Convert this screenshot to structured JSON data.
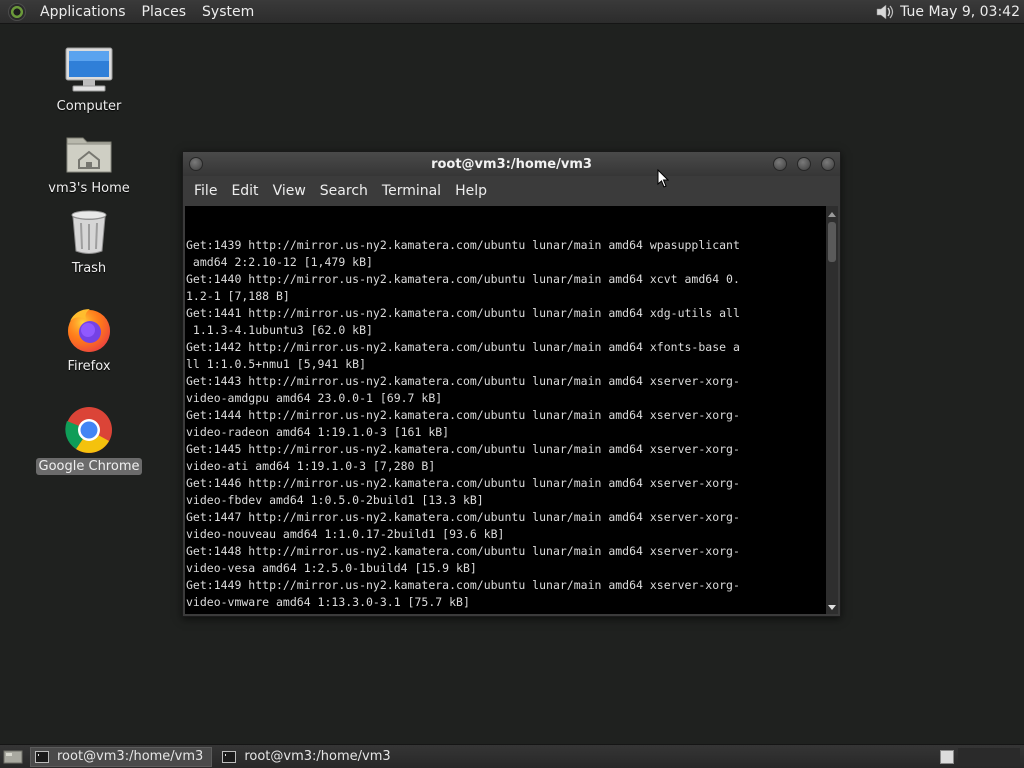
{
  "top_panel": {
    "menu": [
      "Applications",
      "Places",
      "System"
    ],
    "clock": "Tue May  9, 03:42",
    "volume_icon": "speaker-icon"
  },
  "desktop_icons": [
    {
      "label": "Computer",
      "icon": "computer-icon"
    },
    {
      "label": "vm3's Home",
      "icon": "home-folder-icon"
    },
    {
      "label": "Trash",
      "icon": "trash-icon"
    },
    {
      "label": "Firefox",
      "icon": "firefox-icon"
    },
    {
      "label": "Google Chrome",
      "icon": "chrome-icon",
      "selected": true
    }
  ],
  "terminal": {
    "title": "root@vm3:/home/vm3",
    "menu": [
      "File",
      "Edit",
      "View",
      "Search",
      "Terminal",
      "Help"
    ],
    "lines": [
      "Get:1439 http://mirror.us-ny2.kamatera.com/ubuntu lunar/main amd64 wpasupplicant",
      " amd64 2:2.10-12 [1,479 kB]",
      "Get:1440 http://mirror.us-ny2.kamatera.com/ubuntu lunar/main amd64 xcvt amd64 0.",
      "1.2-1 [7,188 B]",
      "Get:1441 http://mirror.us-ny2.kamatera.com/ubuntu lunar/main amd64 xdg-utils all",
      " 1.1.3-4.1ubuntu3 [62.0 kB]",
      "Get:1442 http://mirror.us-ny2.kamatera.com/ubuntu lunar/main amd64 xfonts-base a",
      "ll 1:1.0.5+nmu1 [5,941 kB]",
      "Get:1443 http://mirror.us-ny2.kamatera.com/ubuntu lunar/main amd64 xserver-xorg-",
      "video-amdgpu amd64 23.0.0-1 [69.7 kB]",
      "Get:1444 http://mirror.us-ny2.kamatera.com/ubuntu lunar/main amd64 xserver-xorg-",
      "video-radeon amd64 1:19.1.0-3 [161 kB]",
      "Get:1445 http://mirror.us-ny2.kamatera.com/ubuntu lunar/main amd64 xserver-xorg-",
      "video-ati amd64 1:19.1.0-3 [7,280 B]",
      "Get:1446 http://mirror.us-ny2.kamatera.com/ubuntu lunar/main amd64 xserver-xorg-",
      "video-fbdev amd64 1:0.5.0-2build1 [13.3 kB]",
      "Get:1447 http://mirror.us-ny2.kamatera.com/ubuntu lunar/main amd64 xserver-xorg-",
      "video-nouveau amd64 1:1.0.17-2build1 [93.6 kB]",
      "Get:1448 http://mirror.us-ny2.kamatera.com/ubuntu lunar/main amd64 xserver-xorg-",
      "video-vesa amd64 1:2.5.0-1build4 [15.9 kB]",
      "Get:1449 http://mirror.us-ny2.kamatera.com/ubuntu lunar/main amd64 xserver-xorg-",
      "video-vmware amd64 1:13.3.0-3.1 [75.7 kB]"
    ]
  },
  "taskbar": {
    "tasks": [
      {
        "label": "root@vm3:/home/vm3",
        "active": true
      },
      {
        "label": "root@vm3:/home/vm3",
        "active": false
      }
    ]
  },
  "colors": {
    "desktop": "#1f211f",
    "panel": "#2c2c2c",
    "terminal_bg": "#000000",
    "terminal_fg": "#dcdcdc"
  }
}
